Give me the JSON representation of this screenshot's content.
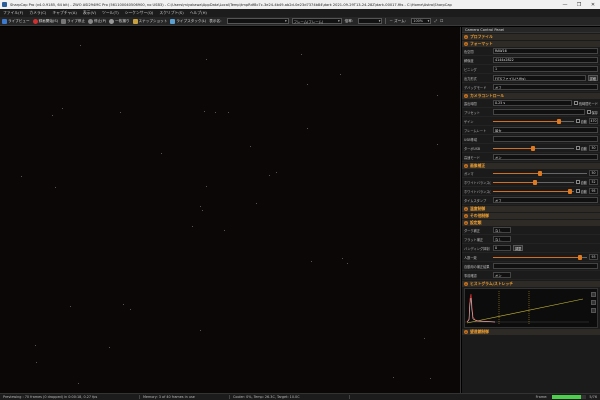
{
  "window": {
    "title": "SharpCap Pro (v4.0.9185, 64 bit) - ZWO ASI294MC Pro (561100040506900, no USB3) - C:\\Users\\miyakawa\\AppData\\Local\\Temp\\tmpRdf8c7c-3e24-4b49-ab2d-0e23d7374b84\\dark 2021-09-29T13-24-28Z\\dark-00017.fits - C:\\Home\\Astro\\SharpCap",
    "controls": [
      "—",
      "❐",
      "✕"
    ]
  },
  "menu": [
    "ファイル(F)",
    "カメラ(C)",
    "キャプチャ(A)",
    "表示(V)",
    "ツール(T)",
    "シーケンサー(Q)",
    "スクリプト(S)",
    "ヘルプ(H)"
  ],
  "toolbar": {
    "live": "ライブビュー",
    "start": "録画開始(S)",
    "stop": "ライブ停止",
    "pause": "停止(P)",
    "oneshot": "一枚撮り",
    "snapshot": "スナップショット",
    "livestack": "ライブスタック(L)",
    "display_label": "表示名：",
    "display_select": "",
    "frame_select": "フレーム(フレーム)",
    "gain_label": "倍率：",
    "zoom_label": "ズーム：",
    "zoom_value": "100%"
  },
  "viewport": {
    "background": "#0a0706"
  },
  "panel": {
    "title": "Camera Control Panel",
    "sections": {
      "profile": "プロファイル",
      "format": "フォーマット",
      "camera_controls": "カメラコントロール",
      "image_adjust": "画像補正",
      "temperature": "温度制御",
      "misc": "その他制御",
      "settings": "設定類",
      "histogram": "ヒストグラム/ストレッチ",
      "dark_management": "望遠鏡制御"
    },
    "format": {
      "color_space_label": "色空間",
      "color_space": "RAW16",
      "resolution_label": "解像度",
      "resolution": "4144x2822",
      "binning_label": "ビニング",
      "binning": "1",
      "output_label": "出力形式",
      "output": "FITSファイル(*.fits)",
      "output_button": "詳細",
      "trigger_label": "デバッグモード",
      "trigger": "オフ"
    },
    "camera": {
      "exposure_label": "露出時間",
      "exposure_value": "0.25 s",
      "exposure_auto": "長時間モード",
      "preset_label": "プリセット",
      "preset_value": "",
      "preset_auto": "保存",
      "gain_label": "ゲイン",
      "gain_value": "470",
      "gain_auto": "自動",
      "framerate_label": "フレームレート",
      "framerate_value": "最大",
      "usb_label": "USB帯域",
      "usb_value": "",
      "turbo_label": "ターボUSB",
      "turbo_value": "50",
      "turbo_auto": "自動",
      "hdr_label": "高速モード",
      "hdr_value": "オン",
      "gain_level": 0.82,
      "turbo_level": 0.5
    },
    "image": {
      "gamma_label": "ガンマ",
      "gamma_value": "50",
      "wb_red_label": "ホワイトバランス(赤)",
      "wb_red_value": "52",
      "wb_red_auto": "自動",
      "wb_blue_label": "ホワイトバランス(青)",
      "wb_blue_value": "95",
      "wb_blue_auto": "自動",
      "timestamp_label": "タイムスタンプ",
      "timestamp_value": "オフ",
      "gamma_level": 0.5,
      "wb_red_level": 0.52,
      "wb_blue_level": 0.95
    },
    "settings": {
      "dark_label": "ダーク補正",
      "dark_value": "なし",
      "flat_label": "フラット補正",
      "flat_value": "なし",
      "banding_label": "バンディング抑制",
      "banding_value": "0",
      "banding_button": "調整",
      "offset_label": "人数一致",
      "offset_value": "93",
      "offset_level": 0.93,
      "filter_label": "自動用の補正結果",
      "filter_value": "",
      "preview_label": "事前確認",
      "preview_value": "オン"
    }
  },
  "status": {
    "preview": "Previewing : 70 frames (0 dropped) in 0:00:18, 0.27 fps",
    "memory": "Memory: 3 of 40 frames in use",
    "camera": "Cooler: 0%, Temp: 26.3C, Target: 10.0C",
    "frame": "Frame:",
    "frame_count": "5/76",
    "progress": 0.85,
    "accent": "#4cd04c"
  }
}
